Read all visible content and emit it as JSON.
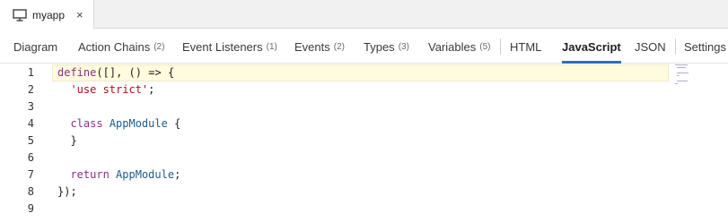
{
  "file_tab": {
    "label": "myapp",
    "close_glyph": "×",
    "icon": "monitor-icon"
  },
  "editor_tabs": [
    {
      "label": "Diagram",
      "count": ""
    },
    {
      "label": "Action Chains",
      "count": "(2)"
    },
    {
      "label": "Event Listeners",
      "count": "(1)"
    },
    {
      "label": "Events",
      "count": "(2)"
    },
    {
      "label": "Types",
      "count": "(3)"
    },
    {
      "label": "Variables",
      "count": "(5)"
    },
    {
      "label": "HTML",
      "count": ""
    },
    {
      "label": "JavaScript",
      "count": "",
      "active": true
    },
    {
      "label": "JSON",
      "count": ""
    },
    {
      "label": "Settings",
      "count": ""
    }
  ],
  "code": {
    "line_numbers": [
      "1",
      "2",
      "3",
      "4",
      "5",
      "6",
      "7",
      "8",
      "9"
    ],
    "lines": [
      "define([], () => {",
      "  'use strict';",
      "",
      "  class AppModule {",
      "  }",
      "",
      "  return AppModule;",
      "});",
      ""
    ]
  },
  "colors": {
    "active_tab_underline": "#2f6fb8",
    "current_line_bg": "#fffbdd",
    "keyword": "#8a2f88",
    "string": "#a31515",
    "identifier": "#1e5c8a"
  }
}
